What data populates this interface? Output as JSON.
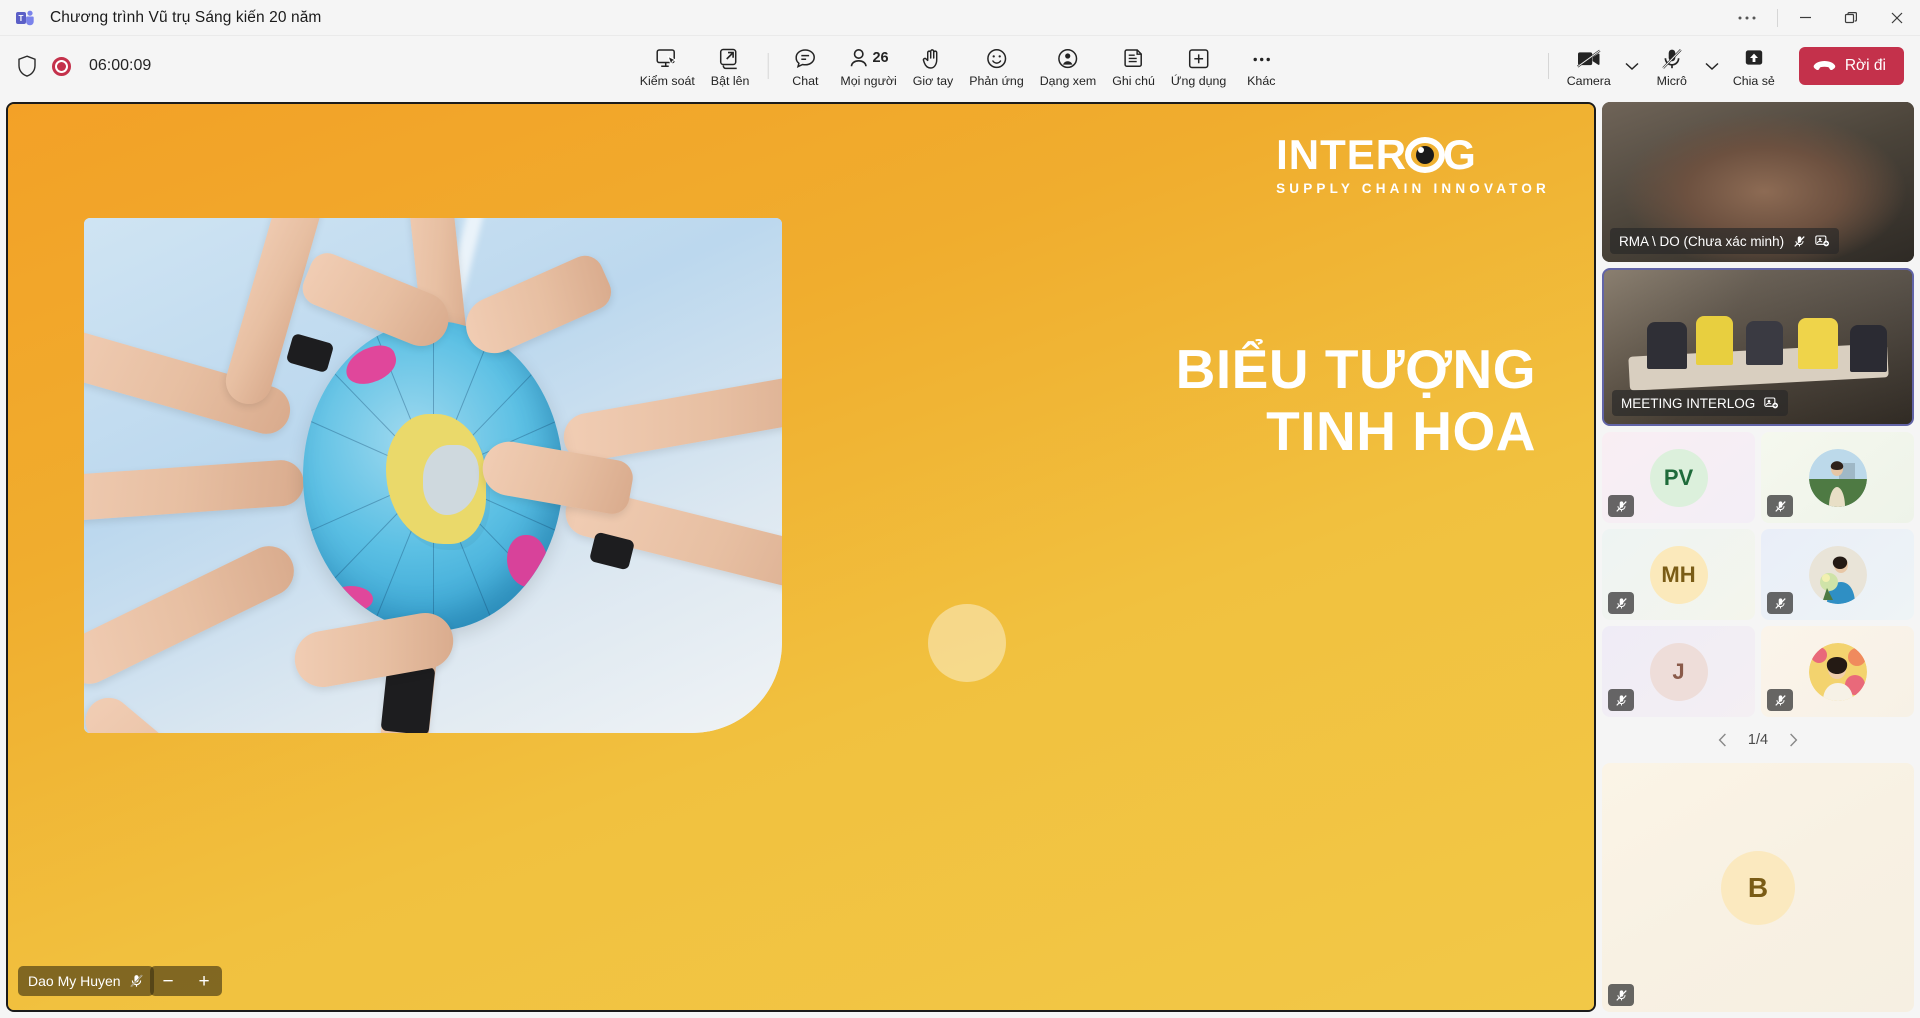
{
  "window": {
    "app_icon": "teams-logo-icon",
    "title": "Chương trình Vũ trụ Sáng kiến 20 năm",
    "more_label": "···",
    "minimize_label": "—",
    "restore_label": "❐",
    "close_label": "✕"
  },
  "toolbar": {
    "shield_icon": "shield-icon",
    "recording_icon": "recording-dot-icon",
    "timer": "06:00:09",
    "items": [
      {
        "id": "control",
        "label": "Kiểm soát",
        "icon": "monitor-cursor-icon"
      },
      {
        "id": "popout",
        "label": "Bật lên",
        "icon": "pop-out-icon"
      },
      {
        "id": "chat",
        "label": "Chat",
        "icon": "chat-bubble-icon"
      },
      {
        "id": "people",
        "label": "Mọi người",
        "icon": "person-icon",
        "badge": "26"
      },
      {
        "id": "raise-hand",
        "label": "Giơ tay",
        "icon": "raised-hand-icon"
      },
      {
        "id": "reactions",
        "label": "Phản ứng",
        "icon": "smiley-icon"
      },
      {
        "id": "view",
        "label": "Dạng xem",
        "icon": "view-person-icon"
      },
      {
        "id": "notes",
        "label": "Ghi chú",
        "icon": "notes-icon"
      },
      {
        "id": "apps",
        "label": "Ứng dụng",
        "icon": "plus-box-icon"
      },
      {
        "id": "more",
        "label": "Khác",
        "icon": "ellipsis-icon"
      }
    ],
    "camera": {
      "label": "Camera",
      "icon": "camera-off-icon",
      "chevron": "chevron-down-icon"
    },
    "mic": {
      "label": "Micrô",
      "icon": "mic-off-icon",
      "chevron": "chevron-down-icon"
    },
    "share": {
      "label": "Chia sẻ",
      "icon": "share-screen-icon"
    },
    "leave": {
      "label": "Rời đi",
      "icon": "hangup-icon"
    }
  },
  "stage": {
    "logo": {
      "text_left": "INTER",
      "text_right": "G",
      "tagline": "SUPPLY CHAIN INNOVATOR"
    },
    "title_line1": "BIỂU TƯỢNG",
    "title_line2": "TINH HOA",
    "presenter": {
      "name": "Dao My Huyen",
      "mic_icon": "mic-off-icon"
    },
    "zoom": {
      "minus": "−",
      "plus": "+"
    }
  },
  "rail": {
    "video_tiles": [
      {
        "name": "RMA \\ DO (Chưa xác minh)",
        "mic_icon": "mic-off-icon",
        "pin_icon": "pin-video-icon",
        "active": false
      },
      {
        "name": "MEETING INTERLOG",
        "pin_icon": "pin-video-icon",
        "active": true
      }
    ],
    "participants": [
      {
        "initials": "PV",
        "type": "initials",
        "bg": "#e3f3e3",
        "fg": "#1e6b3a",
        "tile_bg": "#f7eef3",
        "muted": true
      },
      {
        "initials": "",
        "type": "photo",
        "photo": "woman-outdoors",
        "tile_bg": "#f4f7ee",
        "muted": true
      },
      {
        "initials": "MH",
        "type": "initials",
        "bg": "#fcedb9",
        "fg": "#7a5c16",
        "tile_bg": "#f2f6f3",
        "muted": true
      },
      {
        "initials": "",
        "type": "photo",
        "photo": "woman-with-flowers",
        "tile_bg": "#eef1f8",
        "muted": true
      },
      {
        "initials": "J",
        "type": "initials",
        "bg": "#eeddd9",
        "fg": "#8a5a4a",
        "tile_bg": "#f2eff6",
        "muted": true
      },
      {
        "initials": "",
        "type": "photo",
        "photo": "woman-smiling",
        "tile_bg": "#faf4ec",
        "muted": true
      }
    ],
    "pager": {
      "prev_icon": "chevron-left-icon",
      "label": "1/4",
      "next_icon": "chevron-right-icon"
    },
    "spotlight": {
      "initials": "B",
      "bg": "#fbe9bf",
      "fg": "#7a5c16",
      "muted": true
    }
  },
  "colors": {
    "accent_slide": "#f0ad2e",
    "leave_red": "#c4314b",
    "teams_purple": "#6264a7",
    "recording_red": "#c4314b",
    "chrome_bg": "#f5f5f5"
  }
}
